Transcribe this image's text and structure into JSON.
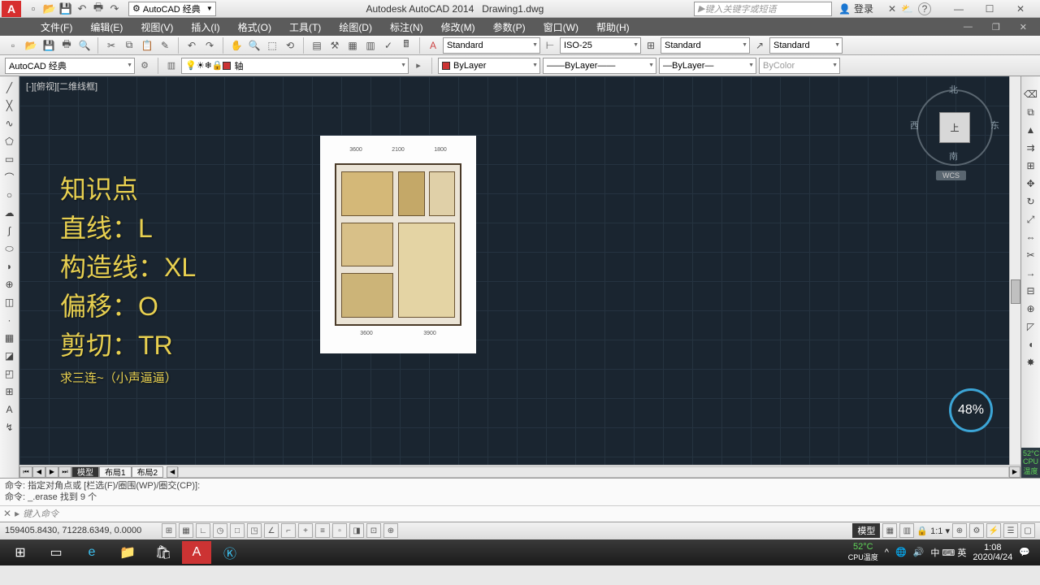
{
  "title": {
    "app": "Autodesk AutoCAD 2014",
    "file": "Drawing1.dwg",
    "workspace": "AutoCAD 经典",
    "search_placeholder": "键入关键字或短语",
    "login": "登录"
  },
  "menu": [
    "文件(F)",
    "编辑(E)",
    "视图(V)",
    "插入(I)",
    "格式(O)",
    "工具(T)",
    "绘图(D)",
    "标注(N)",
    "修改(M)",
    "参数(P)",
    "窗口(W)",
    "帮助(H)"
  ],
  "ribbon1": {
    "annot_style": "Standard",
    "dim_style": "ISO-25",
    "table_style": "Standard",
    "text_style": "Standard"
  },
  "ribbon2": {
    "workspace": "AutoCAD 经典",
    "layer_axis": "轴",
    "linetype": "ByLayer",
    "lineweight": "ByLayer",
    "lineweight2": "ByLayer",
    "color": "ByColor"
  },
  "viewport_label": "[-][俯视][二维线框]",
  "knowledge": {
    "title": "知识点",
    "line": "直线：L",
    "xline": "构造线：XL",
    "offset": "偏移：O",
    "trim": "剪切：TR",
    "footer": "求三连~（小声逼逼）"
  },
  "floorplan": {
    "dims_top": [
      "3600",
      "2100",
      "1800"
    ],
    "dims_bot": [
      "3600",
      "3900"
    ]
  },
  "navcube": {
    "n": "北",
    "s": "南",
    "e": "东",
    "w": "西",
    "top": "上",
    "wcs": "WCS"
  },
  "cpu": {
    "pct": "48%",
    "temp": "52°C",
    "label": "CPU温度"
  },
  "tabs": {
    "model": "模型",
    "layout1": "布局1",
    "layout2": "布局2"
  },
  "cmd": {
    "l1": "命令: 指定对角点或 [栏选(F)/圈围(WP)/圈交(CP)]:",
    "l2": "命令: _.erase 找到 9 个",
    "prompt": "键入命令"
  },
  "status": {
    "coords": "159405.8430, 71228.6349, 0.0000",
    "model": "模型",
    "scale": "1:1"
  },
  "tray": {
    "temp": "52°C",
    "temp_lbl": "CPU温度",
    "ime": "中 ⌨ 英",
    "time": "1:08",
    "date": "2020/4/24"
  }
}
